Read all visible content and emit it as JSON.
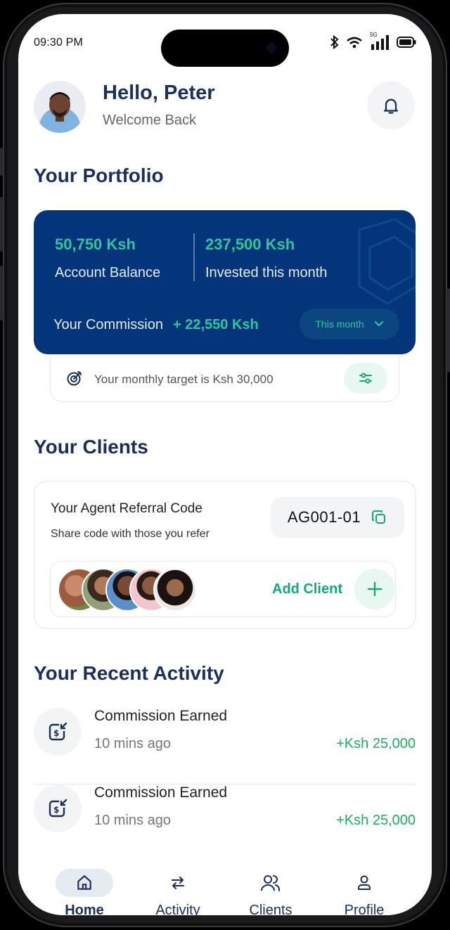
{
  "status_bar": {
    "time": "09:30 PM",
    "network": "5G"
  },
  "header": {
    "greeting": "Hello, Peter",
    "subtitle": "Welcome Back",
    "avatar_icon": "user-photo"
  },
  "portfolio": {
    "title": "Your Portfolio",
    "account_balance": "50,750 Ksh",
    "account_balance_label": "Account Balance",
    "invested": "237,500 Ksh",
    "invested_label": "Invested this month",
    "commission_label": "Your Commission",
    "commission_value": "+ 22,550 Ksh",
    "period_select": "This month",
    "target_text": "Your monthly target is Ksh 30,000",
    "colors": {
      "card": "#04357a",
      "accent": "#2dc79b"
    }
  },
  "clients": {
    "title": "Your Clients",
    "referral_title": "Your Agent Referral Code",
    "referral_subtitle": "Share code with those you refer",
    "referral_code": "AG001-01",
    "add_client_label": "Add Client"
  },
  "activity": {
    "title": "Your Recent Activity",
    "items": [
      {
        "title": "Commission Earned",
        "time": "10 mins ago",
        "amount": "+Ksh 25,000"
      },
      {
        "title": "Commission Earned",
        "time": "10 mins ago",
        "amount": "+Ksh 25,000"
      }
    ]
  },
  "nav": {
    "items": [
      {
        "label": "Home",
        "icon": "home-icon"
      },
      {
        "label": "Activity",
        "icon": "transfer-icon"
      },
      {
        "label": "Clients",
        "icon": "users-icon"
      },
      {
        "label": "Profile",
        "icon": "user-icon"
      }
    ],
    "active": "Home"
  }
}
